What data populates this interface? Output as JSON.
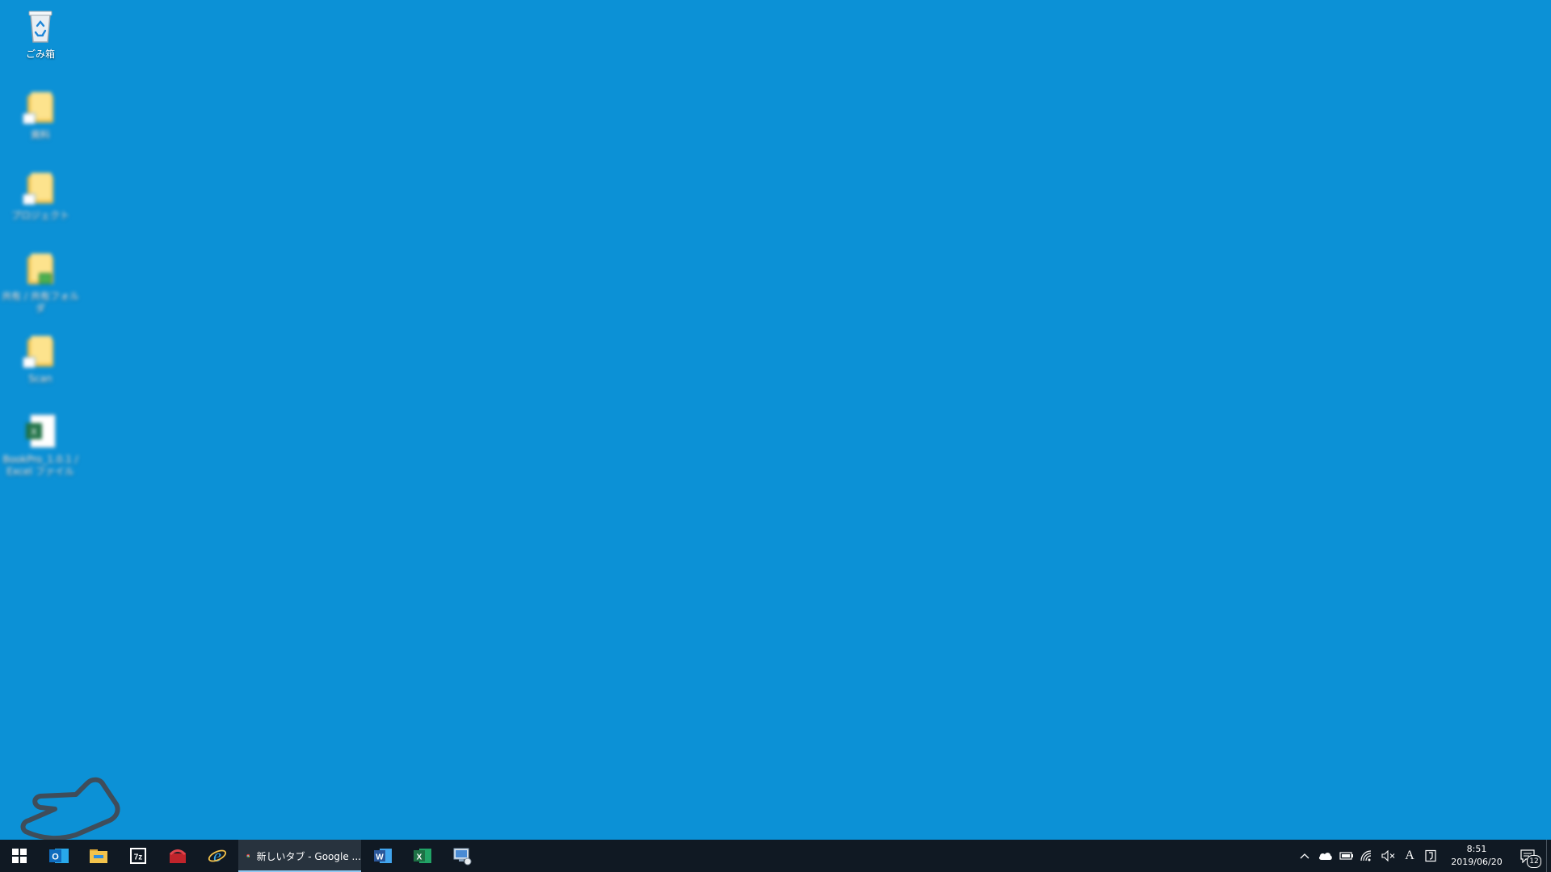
{
  "desktop": {
    "icons": [
      {
        "label": "ごみ箱",
        "icon": "recycle-bin-icon",
        "blurred": false
      },
      {
        "label": "資料",
        "icon": "folder-shortcut-icon",
        "blurred": true
      },
      {
        "label": "プロジェクト",
        "icon": "folder-shortcut-icon",
        "blurred": true
      },
      {
        "label": "共有 / 共有フォルダ",
        "icon": "folder-shortcut-icon",
        "blurred": true
      },
      {
        "label": "Scan",
        "icon": "folder-shortcut-icon",
        "blurred": true
      },
      {
        "label": "BookPro_1.0.1 / Excel ファイル",
        "icon": "excel-file-icon",
        "blurred": true
      }
    ]
  },
  "taskbar": {
    "start": "windows-start-icon",
    "pinned": [
      {
        "name": "outlook-icon",
        "letter": "O",
        "color": "#0f6cbd"
      },
      {
        "name": "file-explorer-icon",
        "color": "#f3c34b"
      },
      {
        "name": "7zip-icon",
        "letter": "7z",
        "color": "#ffffff"
      },
      {
        "name": "red-app-icon",
        "color": "#c0242b"
      },
      {
        "name": "internet-explorer-icon",
        "letter": "e",
        "color": "#3ba7e8"
      }
    ],
    "active_window": {
      "title": "新しいタブ - Google ...",
      "icon": "chrome-icon"
    },
    "after": [
      {
        "name": "word-icon",
        "letter": "W",
        "color": "#2b579a"
      },
      {
        "name": "excel-icon",
        "letter": "X",
        "color": "#1e7145"
      },
      {
        "name": "remote-desktop-icon",
        "color": "#4a8bd4"
      }
    ]
  },
  "tray": {
    "icons": [
      "chevron-up-icon",
      "onedrive-icon",
      "battery-icon",
      "wifi-icon",
      "volume-muted-icon"
    ],
    "ime": "A",
    "clock": {
      "time": "8:51",
      "date": "2019/06/20"
    },
    "notifications": "12"
  }
}
